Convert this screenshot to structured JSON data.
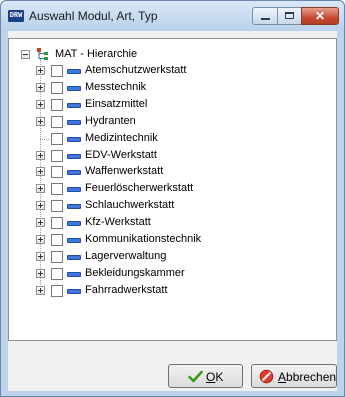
{
  "window": {
    "app_icon_text": "DRW",
    "title": "Auswahl Modul, Art, Typ"
  },
  "tree": {
    "root": {
      "label": "MAT - Hierarchie",
      "expanded": true
    },
    "items": [
      {
        "label": "Atemschutzwerkstatt",
        "has_children": true,
        "checked": false
      },
      {
        "label": "Messtechnik",
        "has_children": true,
        "checked": false
      },
      {
        "label": "Einsatzmittel",
        "has_children": true,
        "checked": false
      },
      {
        "label": "Hydranten",
        "has_children": true,
        "checked": false
      },
      {
        "label": "Medizintechnik",
        "has_children": false,
        "checked": false
      },
      {
        "label": "EDV-Werkstatt",
        "has_children": true,
        "checked": false
      },
      {
        "label": "Waffenwerkstatt",
        "has_children": true,
        "checked": false
      },
      {
        "label": "Feuerlöscherwerkstatt",
        "has_children": true,
        "checked": false
      },
      {
        "label": "Schlauchwerkstatt",
        "has_children": true,
        "checked": false
      },
      {
        "label": "Kfz-Werkstatt",
        "has_children": true,
        "checked": false
      },
      {
        "label": "Kommunikationstechnik",
        "has_children": true,
        "checked": false
      },
      {
        "label": "Lagerverwaltung",
        "has_children": true,
        "checked": false
      },
      {
        "label": "Bekleidungskammer",
        "has_children": true,
        "checked": false
      },
      {
        "label": "Fahrradwerkstatt",
        "has_children": true,
        "checked": false
      }
    ]
  },
  "buttons": {
    "ok": {
      "mnemonic": "O",
      "rest": "K",
      "icon": "checkmark-icon"
    },
    "cancel": {
      "mnemonic": "A",
      "rest": "bbrechen",
      "icon": "cancel-icon"
    }
  },
  "colors": {
    "titlebar": "#c4d9ef",
    "item_icon": "#3d78d8",
    "close_button": "#c94a33"
  }
}
